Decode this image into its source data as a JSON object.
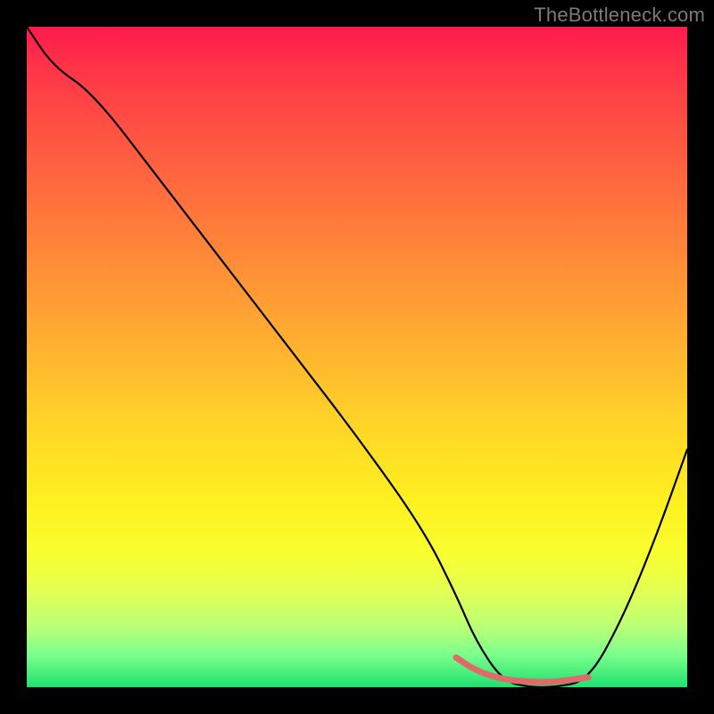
{
  "attribution": "TheBottleneck.com",
  "chart_data": {
    "type": "line",
    "title": "",
    "xlabel": "",
    "ylabel": "",
    "xlim": [
      0,
      100
    ],
    "ylim": [
      0,
      100
    ],
    "x": [
      0,
      4,
      10,
      20,
      30,
      40,
      50,
      60,
      65,
      68,
      72,
      76,
      80,
      85,
      90,
      95,
      100
    ],
    "values": [
      100,
      94,
      90,
      77,
      64,
      51,
      38,
      24,
      14,
      7,
      1,
      0,
      0,
      1,
      10,
      22,
      36
    ],
    "accent_segment": {
      "x": [
        65,
        68,
        72,
        76,
        80,
        85
      ],
      "values": [
        4.5,
        2.5,
        1.2,
        0.8,
        0.8,
        1.5
      ]
    },
    "colors": {
      "curve": "#000000",
      "accent": "#e06a6a",
      "gradient_top": "#ff1a4d",
      "gradient_bottom": "#20e070"
    }
  }
}
